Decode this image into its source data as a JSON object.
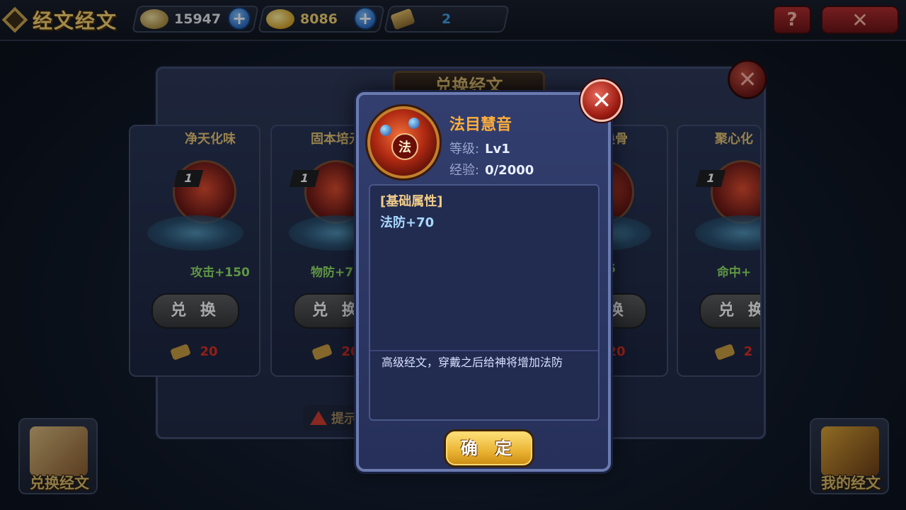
{
  "header": {
    "title": "经文经文",
    "copper": "15947",
    "gold": "8086",
    "scroll": "2",
    "help_label": "?",
    "close_label": "✕"
  },
  "exchange_panel": {
    "title": "兑换经文",
    "close_label": "✕",
    "hint_label": "提示",
    "cards": [
      {
        "title": "净天化味",
        "level": "1",
        "stat": "攻击+150",
        "button": "兑 换",
        "cost": "20"
      },
      {
        "title": "固本培元",
        "level": "1",
        "stat": "物防+70",
        "button": "兑 换",
        "cost": "20"
      },
      {
        "title": "脱胎换骨",
        "level": "1",
        "stat": "+45",
        "button": "兑 换",
        "cost": "20"
      },
      {
        "title": "聚心化",
        "level": "1",
        "stat": "命中+",
        "button": "兑 换",
        "cost": "2"
      }
    ]
  },
  "corner_buttons": {
    "exchange_label": "兑换经文",
    "mine_label": "我的经文"
  },
  "modal": {
    "name": "法目慧音",
    "level_label": "等级:",
    "level_value": "Lv1",
    "exp_label": "经验:",
    "exp_value": "0/2000",
    "icon_glyph": "法",
    "section_title": "[基础属性]",
    "attribute": "法防+70",
    "description": "高级经文，穿戴之后给神将增加法防",
    "confirm_label": "确 定",
    "close_label": "✕"
  },
  "colors": {
    "accent_gold": "#f5d26e",
    "item_name": "#ffae3a",
    "stat_green": "#8fe060",
    "cost_red": "#e02a1a"
  }
}
